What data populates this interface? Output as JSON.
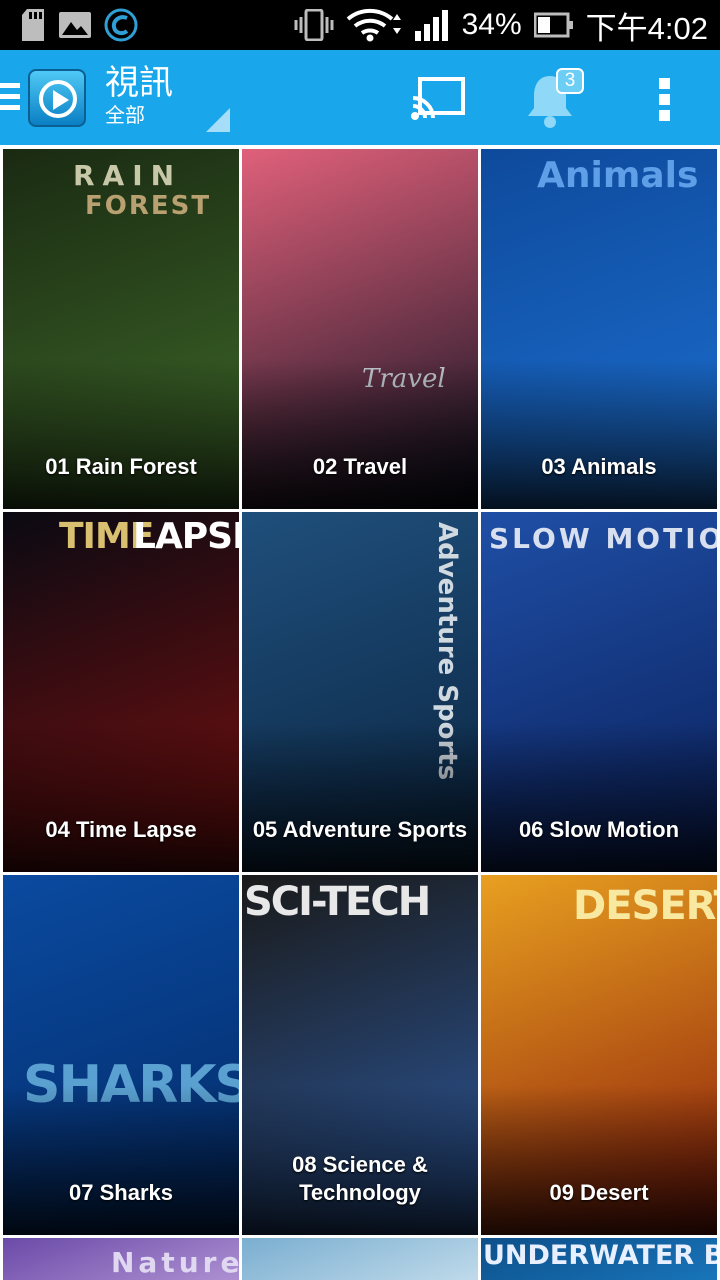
{
  "status_bar": {
    "battery_percent": "34%",
    "time": "下午4:02"
  },
  "app_bar": {
    "title": "視訊",
    "subtitle": "全部",
    "notification_count": "3",
    "color": "#1aa6ea"
  },
  "videos": [
    {
      "label": "01 Rain Forest",
      "cover_text": "RAIN",
      "cover_text2": "FOREST",
      "colors": [
        "#1a2a12",
        "#3f6a2a"
      ]
    },
    {
      "label": "02 Travel",
      "cover_text": "Travel",
      "colors": [
        "#e0607a",
        "#0b1020"
      ]
    },
    {
      "label": "03 Animals",
      "cover_text": "Animals",
      "colors": [
        "#0e4a9c",
        "#1c6fd0"
      ]
    },
    {
      "label": "04 Time Lapse",
      "cover_text": "TIME",
      "cover_text2": "LAPSE",
      "colors": [
        "#0a0a12",
        "#7a1010"
      ]
    },
    {
      "label": "05 Adventure Sports",
      "cover_text": "Adventure Sports",
      "colors": [
        "#1f4f7c",
        "#0a2440"
      ]
    },
    {
      "label": "06 Slow Motion",
      "cover_text": "SLOW MOTION",
      "colors": [
        "#1f4fa6",
        "#0a1f5a"
      ]
    },
    {
      "label": "07 Sharks",
      "cover_text": "SHARKS",
      "colors": [
        "#0a4aa0",
        "#032a66"
      ]
    },
    {
      "label": "08 Science & Technology",
      "cover_text": "SCI-TECH",
      "colors": [
        "#1a1a1a",
        "#2d5aa0"
      ]
    },
    {
      "label": "09 Desert",
      "cover_text": "DESERT",
      "colors": [
        "#e8a020",
        "#8a1a0a"
      ]
    },
    {
      "label": "",
      "cover_text": "Nature",
      "colors": [
        "#6a4aa8",
        "#b79ad8"
      ]
    },
    {
      "label": "",
      "cover_text": "",
      "colors": [
        "#7aaed0",
        "#c9e0ee"
      ]
    },
    {
      "label": "",
      "cover_text": "UNDERWATER BEAUTY",
      "colors": [
        "#0d4f8a",
        "#1a7ac0"
      ]
    }
  ]
}
